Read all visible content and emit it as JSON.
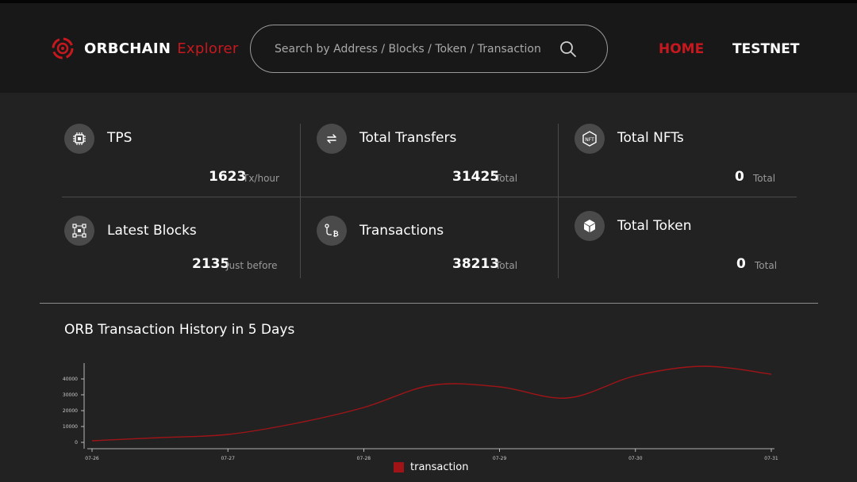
{
  "brand": {
    "name": "ORBCHAIN",
    "suffix": "Explorer"
  },
  "search": {
    "placeholder": "Search by Address / Blocks / Token / Transaction"
  },
  "nav": {
    "home": "HOME",
    "testnet": "TESTNET"
  },
  "colors": {
    "accent": "#c6181e",
    "background": "#222222",
    "header": "#181818",
    "line": "#a01418"
  },
  "stats": {
    "tps": {
      "label": "TPS",
      "value": "1623",
      "unit": "Tx/hour",
      "icon": "cpu-chip-icon"
    },
    "transfers": {
      "label": "Total Transfers",
      "value": "31425",
      "unit": "Total",
      "icon": "transfer-icon"
    },
    "nfts": {
      "label": "Total NFTs",
      "value": "0",
      "unit": "Total",
      "icon": "nft-icon"
    },
    "blocks": {
      "label": "Latest Blocks",
      "value": "2135",
      "unit": "Just before",
      "icon": "blocks-network-icon"
    },
    "transactions": {
      "label": "Transactions",
      "value": "38213",
      "unit": "Total",
      "icon": "bitcoin-flow-icon"
    },
    "tokens": {
      "label": "Total Token",
      "value": "0",
      "unit": "Total",
      "icon": "cube-icon"
    }
  },
  "chart_title": "ORB Transaction History in 5 Days",
  "chart_data": {
    "type": "line",
    "title": "ORB Transaction History in 5 Days",
    "x": [
      "07-26",
      "07-26.5",
      "07-27",
      "07-27.5",
      "07-28",
      "07-28.5",
      "07-29",
      "07-29.5",
      "07-30",
      "07-30.5",
      "07-31"
    ],
    "x_ticks": [
      "07-26",
      "07-27",
      "07-28",
      "07-29",
      "07-30",
      "07-31"
    ],
    "series": [
      {
        "name": "transaction",
        "values": [
          1000,
          3000,
          5000,
          12000,
          22000,
          36000,
          35000,
          28000,
          42000,
          48000,
          43000
        ],
        "color": "#a01418"
      }
    ],
    "y_ticks": [
      0,
      10000,
      20000,
      30000,
      40000
    ],
    "ylim": [
      0,
      50000
    ],
    "grid": false,
    "legend_position": "bottom-center"
  }
}
